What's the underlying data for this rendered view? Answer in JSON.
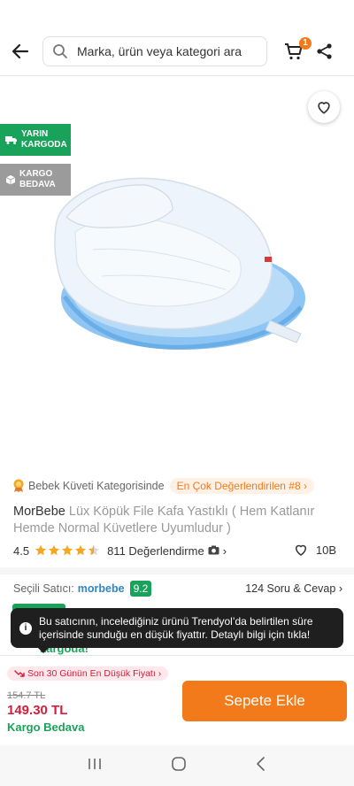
{
  "search": {
    "placeholder": "Marka, ürün veya kategori ara"
  },
  "cart": {
    "badge_count": "1"
  },
  "badges": {
    "fast_delivery": [
      "YARIN",
      "KARGODA"
    ],
    "free_shipping": [
      "KARGO",
      "BEDAVA"
    ]
  },
  "category": {
    "text": "Bebek Küveti Kategorisinde",
    "best_rated": "En Çok Değerlendirilen #8"
  },
  "product": {
    "brand": "MorBebe",
    "name": "Lüx Köpük File Kafa Yastıklı ( Hem Katlanır Hemde Normal Küvetlere Uyumludur )",
    "rating": "4.5",
    "rating_value": 4.5,
    "review_count": "811 Değerlendirme",
    "favorites": "10B"
  },
  "seller": {
    "label": "Seçili Satıcı:",
    "name": "morbebe",
    "score": "9.2",
    "qa": "124 Soru & Cevap"
  },
  "partial": {
    "kargoda": "kargoda!"
  },
  "toast": {
    "text": "Bu satıcının, incelediğiniz ürünü Trendyol’da belirtilen süre içerisinde sunduğu en düşük fiyattır. Detaylı bilgi için tıkla!"
  },
  "bottom": {
    "lowest_label": "Son 30 Günün En Düşük Fiyatı",
    "old_price": "154.7 TL",
    "new_price": "149.30 TL",
    "free_cargo": "Kargo Bedava",
    "add_to_cart": "Sepete Ekle"
  },
  "colors": {
    "accent": "#f27a1a",
    "green": "#19a35a",
    "price_red": "#d21e3c"
  }
}
